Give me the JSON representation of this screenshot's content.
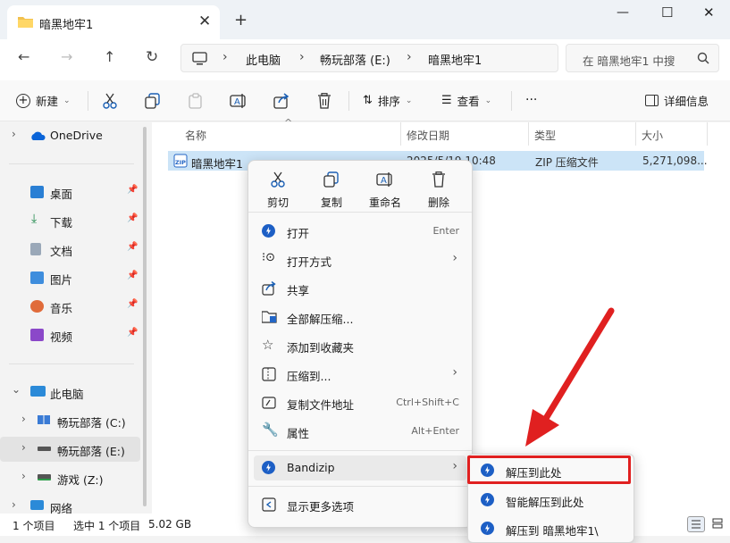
{
  "tab": {
    "title": "暗黑地牢1",
    "close": "✕",
    "new_tab": "+"
  },
  "window": {
    "minimize": "—",
    "maximize": "☐",
    "close": "✕"
  },
  "address": {
    "crumbs": [
      "此电脑",
      "畅玩部落 (E:)",
      "暗黑地牢1"
    ],
    "separator": "›",
    "search_placeholder": "在 暗黑地牢1 中搜"
  },
  "toolbar": {
    "new": "新建",
    "sort": "排序",
    "view": "查看",
    "more": "···",
    "details": "详细信息"
  },
  "sidebar": {
    "onedrive": "OneDrive",
    "quick": [
      "桌面",
      "下载",
      "文档",
      "图片",
      "音乐",
      "视频"
    ],
    "thispc": "此电脑",
    "drives": [
      "畅玩部落 (C:)",
      "畅玩部落 (E:)",
      "游戏 (Z:)"
    ],
    "network": "网络"
  },
  "columns": {
    "name": "名称",
    "date": "修改日期",
    "type": "类型",
    "size": "大小"
  },
  "file": {
    "name": "暗黑地牢1",
    "date": "2025/5/19 10:48",
    "type": "ZIP 压缩文件",
    "size": "5,271,098..."
  },
  "context_menu": {
    "quick_actions": [
      "剪切",
      "复制",
      "重命名",
      "删除"
    ],
    "items": [
      {
        "label": "打开",
        "shortcut": "Enter"
      },
      {
        "label": "打开方式",
        "arrow": "›"
      },
      {
        "label": "共享"
      },
      {
        "label": "全部解压缩..."
      },
      {
        "label": "添加到收藏夹"
      },
      {
        "label": "压缩到...",
        "arrow": "›"
      },
      {
        "label": "复制文件地址",
        "shortcut": "Ctrl+Shift+C"
      },
      {
        "label": "属性",
        "shortcut": "Alt+Enter"
      },
      {
        "label": "Bandizip",
        "arrow": "›"
      },
      {
        "label": "显示更多选项"
      }
    ]
  },
  "submenu": [
    "解压到此处",
    "智能解压到此处",
    "解压到 暗黑地牢1\\"
  ],
  "status": {
    "count": "1 个项目",
    "selected": "选中 1 个项目",
    "size": "5.02 GB"
  },
  "colors": {
    "accent": "#0067c0",
    "highlight": "#e02020",
    "selection": "#cce4f7"
  }
}
